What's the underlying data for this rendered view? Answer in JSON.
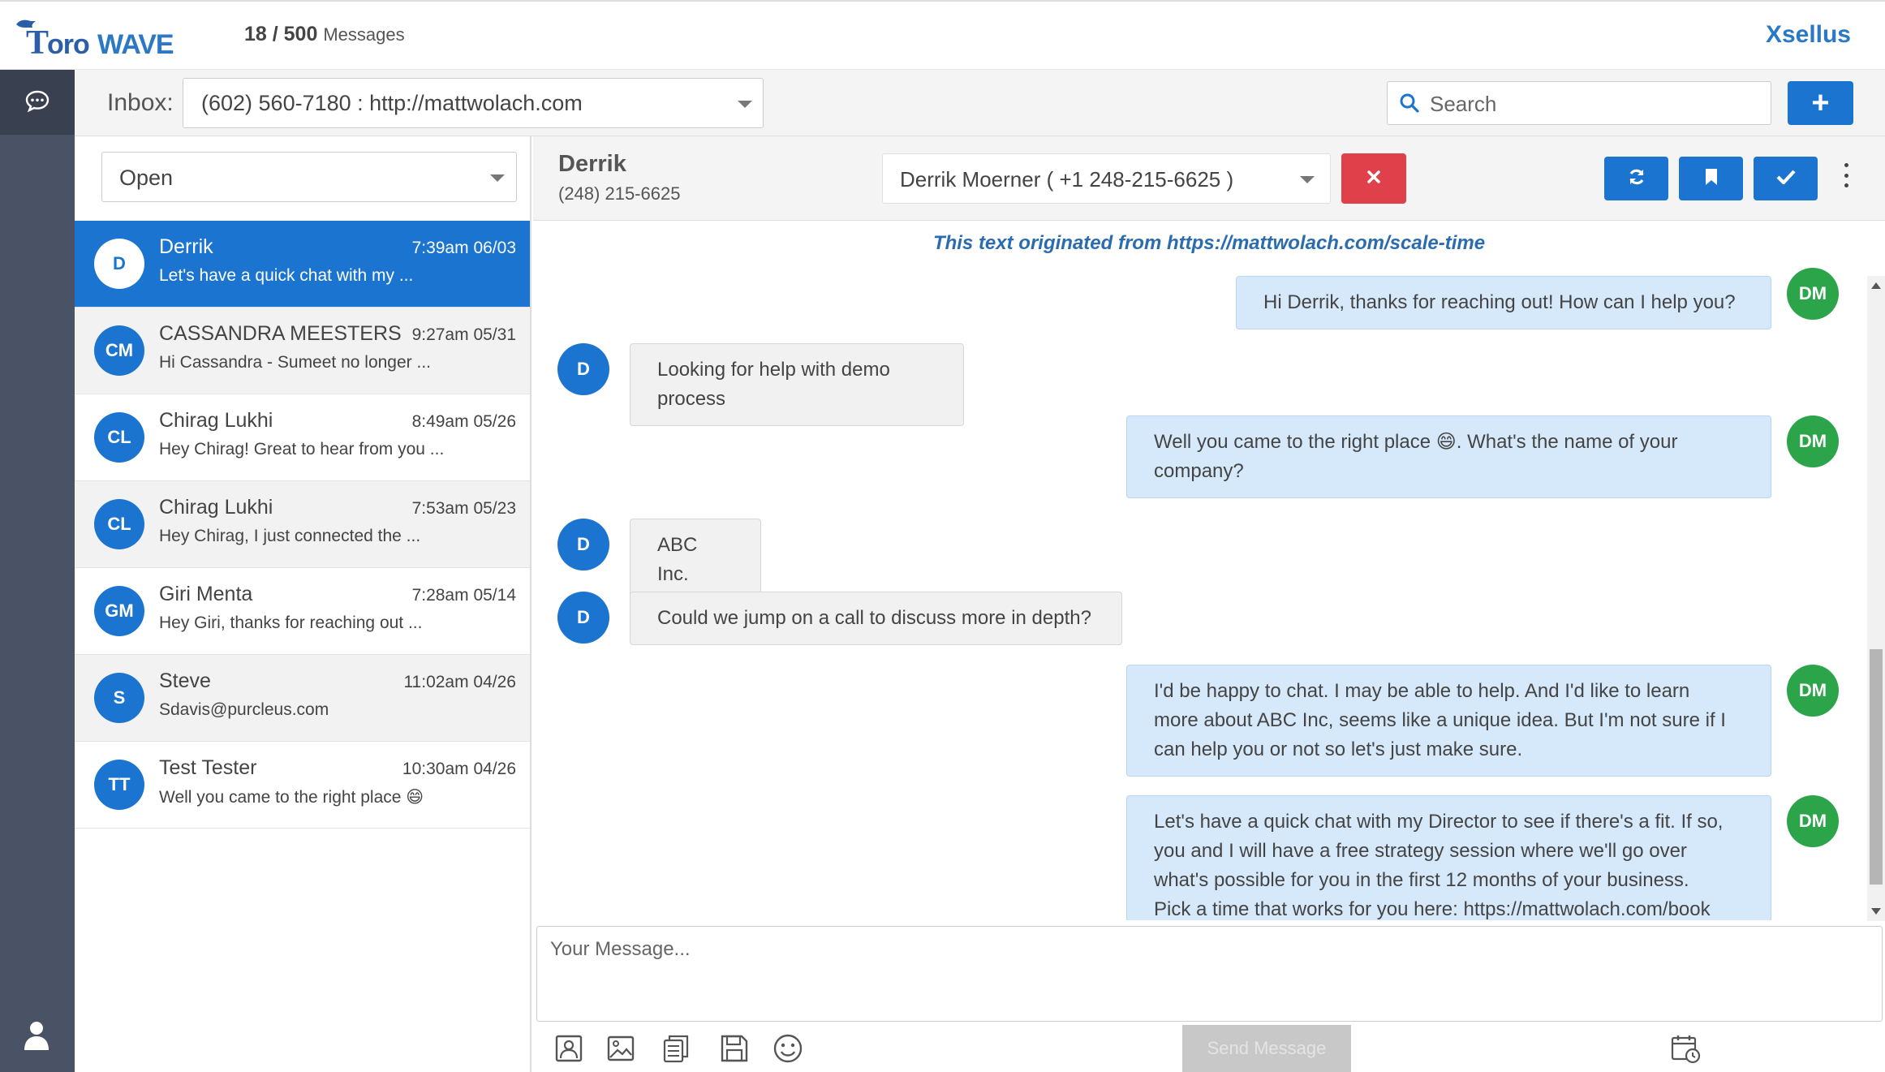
{
  "header": {
    "logo_text": "ToroWave",
    "message_count": "18 / 500",
    "message_count_label": "Messages",
    "brand": "Xsellus"
  },
  "inbox": {
    "label": "Inbox:",
    "selected": "(602) 560-7180 : http://mattwolach.com",
    "search_placeholder": "Search",
    "add_label": "+"
  },
  "list": {
    "status_filter": "Open",
    "conversations": [
      {
        "initials": "D",
        "name": "Derrik",
        "time": "7:39am 06/03",
        "preview": "Let's have a quick chat with my ..."
      },
      {
        "initials": "CM",
        "name": "CASSANDRA MEESTERS",
        "time": "9:27am 05/31",
        "preview": "Hi Cassandra - Sumeet no longer ..."
      },
      {
        "initials": "CL",
        "name": "Chirag Lukhi",
        "time": "8:49am 05/26",
        "preview": "Hey Chirag! Great to hear from you ..."
      },
      {
        "initials": "CL",
        "name": "Chirag Lukhi",
        "time": "7:53am 05/23",
        "preview": "Hey Chirag, I just connected the ..."
      },
      {
        "initials": "GM",
        "name": "Giri Menta",
        "time": "7:28am 05/14",
        "preview": "Hey Giri, thanks for reaching out ..."
      },
      {
        "initials": "S",
        "name": "Steve",
        "time": "11:02am 04/26",
        "preview": "Sdavis@purcleus.com"
      },
      {
        "initials": "TT",
        "name": "Test Tester",
        "time": "10:30am 04/26",
        "preview": "Well you came to the right place 😄"
      }
    ]
  },
  "chat": {
    "contact_name": "Derrik",
    "contact_phone": "(248) 215-6625",
    "contact_select": "Derrik Moerner ( +1 248-215-6625 )",
    "origin_note": "This text originated from https://mattwolach.com/scale-time",
    "messages": [
      {
        "dir": "out",
        "avatar": "DM",
        "text": "Hi Derrik, thanks for reaching out! How can I help you?"
      },
      {
        "dir": "in",
        "avatar": "D",
        "text": "Looking for help with demo process"
      },
      {
        "dir": "out",
        "avatar": "DM",
        "line1": "Well you came to the right place 😄. What's the name of your",
        "line2": "company?"
      },
      {
        "dir": "in",
        "avatar": "D",
        "text": "ABC Inc."
      },
      {
        "dir": "in",
        "avatar": "D",
        "text": "Could we jump on a call to discuss more in depth?"
      },
      {
        "dir": "out",
        "avatar": "DM",
        "line1": "I'd be happy to chat. I may be able to help. And I'd like to learn",
        "line2": "more about ABC Inc, seems like a unique idea. But I'm not sure if I",
        "line3": "can help you or not so let's just make sure."
      },
      {
        "dir": "out",
        "avatar": "DM",
        "line1": "Let's have a quick chat with my Director to see if there's a fit. If so,",
        "line2": "you and I will have a free strategy session where we'll go over",
        "line3": "what's possible for you in the first 12 months of your business.",
        "line4": "Pick a time that works for you here: https://mattwolach.com/book"
      }
    ],
    "composer_placeholder": "Your Message...",
    "send_label": "Send Message"
  },
  "colors": {
    "accent": "#1b75d0",
    "danger": "#e0404a",
    "agent_avatar": "#2ca44a",
    "sidebar": "#4a5366"
  }
}
